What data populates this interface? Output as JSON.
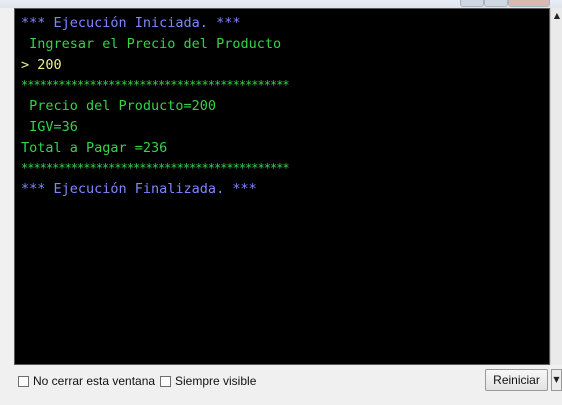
{
  "console": {
    "lines": [
      "*** Ejecución Iniciada. ***",
      " Ingresar el Precio del Producto",
      "> 200",
      "*******************************************",
      " Precio del Producto=200",
      " IGV=36",
      "Total a Pagar =236",
      "*******************************************",
      "*** Ejecución Finalizada. ***"
    ]
  },
  "footer": {
    "no_cerrar_label": "No cerrar esta ventana",
    "siempre_visible_label": "Siempre visible",
    "reiniciar_label": "Reiniciar"
  },
  "icons": {
    "scroll_up": "triangle-up",
    "dropdown": "triangle-down"
  }
}
